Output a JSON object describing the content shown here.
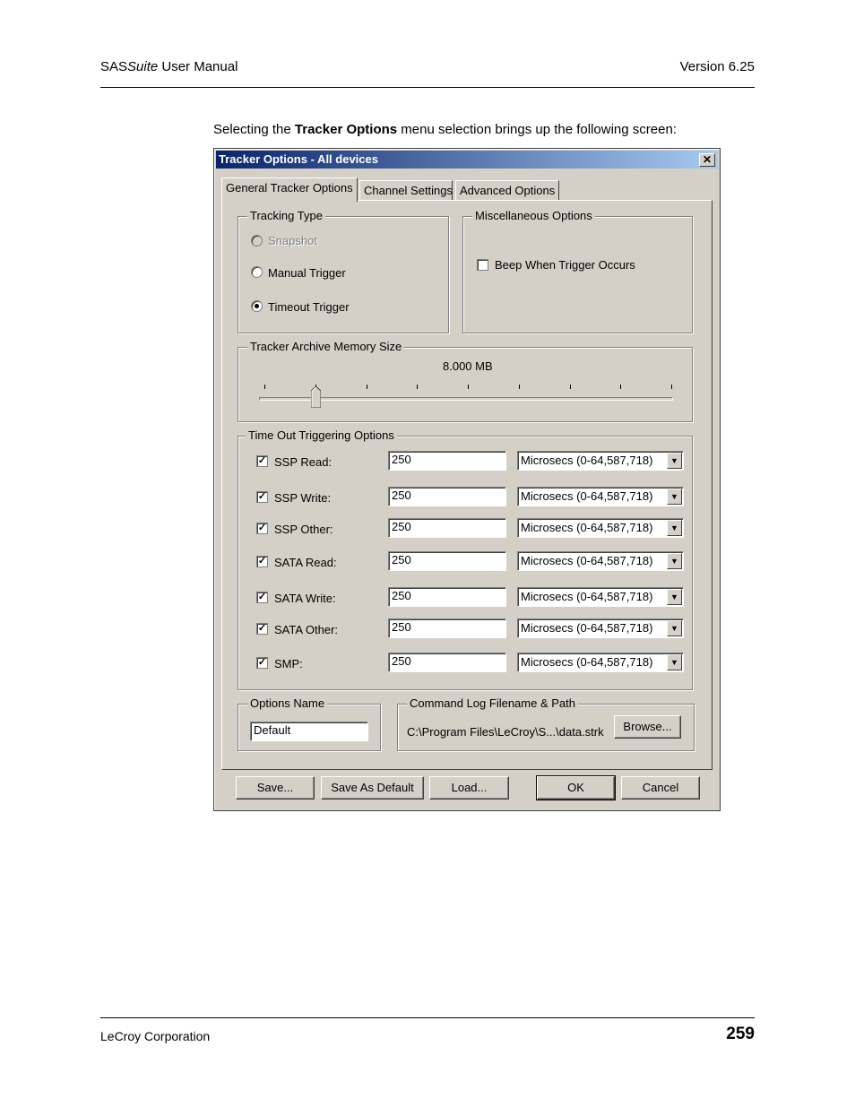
{
  "header": {
    "product_prefix": "SAS",
    "product_italic": "Suite",
    "product_suffix": " User Manual",
    "version": "Version 6.25"
  },
  "intro": {
    "before": "Selecting the ",
    "bold": "Tracker Options",
    "after": " menu selection brings up the following screen:"
  },
  "dialog": {
    "title": "Tracker Options - All devices",
    "close_glyph": "✕",
    "tabs": [
      "General Tracker Options",
      "Channel Settings",
      "Advanced Options"
    ],
    "tracking_type": {
      "label": "Tracking Type",
      "options": [
        {
          "label": "Snapshot",
          "state": "disabled"
        },
        {
          "label": "Manual Trigger",
          "state": "unchecked"
        },
        {
          "label": "Timeout Trigger",
          "state": "checked"
        }
      ]
    },
    "misc": {
      "label": "Miscellaneous Options",
      "beep_label": "Beep When Trigger Occurs",
      "beep_checked": false
    },
    "archive": {
      "label": "Tracker Archive Memory Size",
      "value_text": "8.000 MB",
      "slider_position_fraction": 0.125,
      "tick_count": 9
    },
    "timeout": {
      "label": "Time Out Triggering Options",
      "rows": [
        {
          "label": "SSP Read:",
          "checked": true,
          "value": "250",
          "unit": "Microsecs  (0-64,587,718)"
        },
        {
          "label": "SSP Write:",
          "checked": true,
          "value": "250",
          "unit": "Microsecs  (0-64,587,718)"
        },
        {
          "label": "SSP Other:",
          "checked": true,
          "value": "250",
          "unit": "Microsecs  (0-64,587,718)"
        },
        {
          "label": "SATA Read:",
          "checked": true,
          "value": "250",
          "unit": "Microsecs  (0-64,587,718)"
        },
        {
          "label": "SATA Write:",
          "checked": true,
          "value": "250",
          "unit": "Microsecs  (0-64,587,718)"
        },
        {
          "label": "SATA Other:",
          "checked": true,
          "value": "250",
          "unit": "Microsecs  (0-64,587,718)"
        },
        {
          "label": "SMP:",
          "checked": true,
          "value": "250",
          "unit": "Microsecs  (0-64,587,718)"
        }
      ]
    },
    "options_name": {
      "label": "Options Name",
      "value": "Default"
    },
    "command_log": {
      "label": "Command Log Filename & Path",
      "path": "C:\\Program Files\\LeCroy\\S...\\data.strk",
      "browse_label": "Browse..."
    },
    "buttons": {
      "save": "Save...",
      "save_default": "Save As Default",
      "load": "Load...",
      "ok": "OK",
      "cancel": "Cancel"
    }
  },
  "footer": {
    "company": "LeCroy Corporation",
    "page_number": "259"
  }
}
